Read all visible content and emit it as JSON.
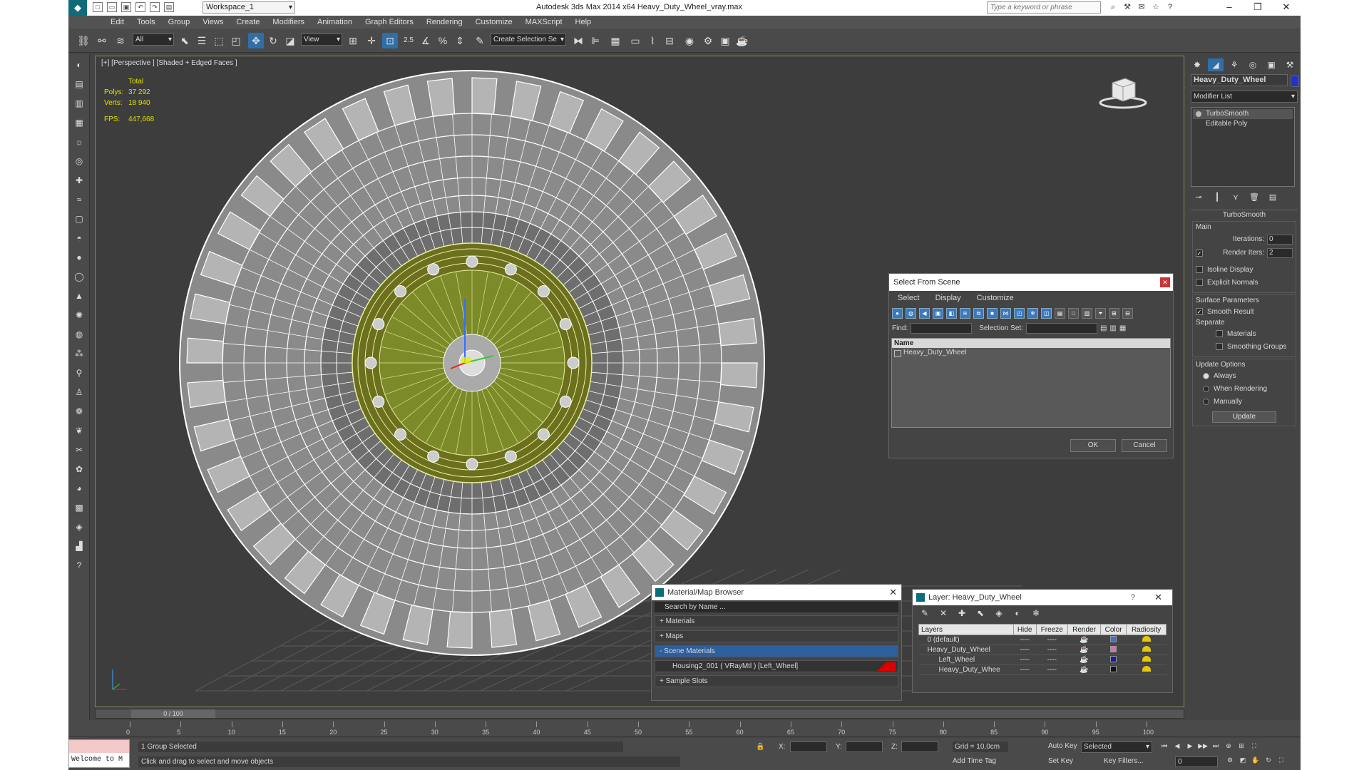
{
  "titlebar": {
    "workspace": "Workspace_1",
    "app_title": "Autodesk 3ds Max  2014 x64      Heavy_Duty_Wheel_vray.max",
    "search_placeholder": "Type a keyword or phrase"
  },
  "menu": [
    "Edit",
    "Tools",
    "Group",
    "Views",
    "Create",
    "Modifiers",
    "Animation",
    "Graph Editors",
    "Rendering",
    "Customize",
    "MAXScript",
    "Help"
  ],
  "toolbar": {
    "filter": "All",
    "ref_coord": "View",
    "snap_value": "2.5",
    "selection_set_placeholder": "Create Selection Se"
  },
  "viewport": {
    "label": "[+] [Perspective ] [Shaded + Edged Faces ]",
    "stats": {
      "header": "Total",
      "polys_label": "Polys:",
      "polys": "37 292",
      "verts_label": "Verts:",
      "verts": "18 940",
      "fps_label": "FPS:",
      "fps": "447,668"
    }
  },
  "command_panel": {
    "object_name": "Heavy_Duty_Wheel",
    "object_color": "#2233cc",
    "modifier_list": "Modifier List",
    "stack": [
      "TurboSmooth",
      "Editable Poly"
    ],
    "rollout_title": "TurboSmooth",
    "main_label": "Main",
    "iterations_label": "Iterations:",
    "iterations": "0",
    "render_iters_label": "Render Iters:",
    "render_iters": "2",
    "isoline": "Isoline Display",
    "explicit_normals": "Explicit Normals",
    "surface_params": "Surface Parameters",
    "smooth_result": "Smooth Result",
    "separate": "Separate",
    "materials": "Materials",
    "smoothing_groups": "Smoothing Groups",
    "update_options": "Update Options",
    "always": "Always",
    "when_rendering": "When Rendering",
    "manually": "Manually",
    "update_btn": "Update"
  },
  "select_from_scene": {
    "title": "Select From Scene",
    "menu": [
      "Select",
      "Display",
      "Customize"
    ],
    "find_label": "Find:",
    "selection_set_label": "Selection Set:",
    "column_name": "Name",
    "items": [
      "Heavy_Duty_Wheel"
    ],
    "ok": "OK",
    "cancel": "Cancel"
  },
  "material_browser": {
    "title": "Material/Map Browser",
    "search": "Search by Name ...",
    "rows": [
      "+ Materials",
      "+ Maps",
      "- Scene Materials"
    ],
    "scene_material": "Housing2_001  ( VRayMtl )  [Left_Wheel]",
    "sample_slots": "+ Sample Slots"
  },
  "layer_dialog": {
    "title": "Layer: Heavy_Duty_Wheel",
    "help": "?",
    "columns": [
      "Layers",
      "Hide",
      "Freeze",
      "Render",
      "Color",
      "Radiosity"
    ],
    "rows": [
      {
        "name": "0 (default)",
        "color": "#3d6fd8"
      },
      {
        "name": "Heavy_Duty_Wheel",
        "color": "#d86fae"
      },
      {
        "name": "Left_Wheel",
        "color": "#1a1aa0"
      },
      {
        "name": "Heavy_Duty_Whee",
        "color": "#111111"
      }
    ],
    "dash": "----"
  },
  "timeline": {
    "slider": "0 / 100",
    "ticks": [
      "0",
      "5",
      "10",
      "15",
      "20",
      "25",
      "30",
      "35",
      "40",
      "45",
      "50",
      "55",
      "60",
      "65",
      "70",
      "75",
      "80",
      "85",
      "90",
      "95",
      "100"
    ]
  },
  "status": {
    "listener": "Welcome to M",
    "selected": "1 Group Selected",
    "prompt": "Click and drag to select and move objects",
    "x_label": "X:",
    "y_label": "Y:",
    "z_label": "Z:",
    "grid": "Grid = 10,0cm",
    "add_time_tag": "Add Time Tag",
    "auto_key": "Auto Key",
    "set_key": "Set Key",
    "selected_mode": "Selected",
    "key_filters": "Key Filters...",
    "frame": "0"
  }
}
